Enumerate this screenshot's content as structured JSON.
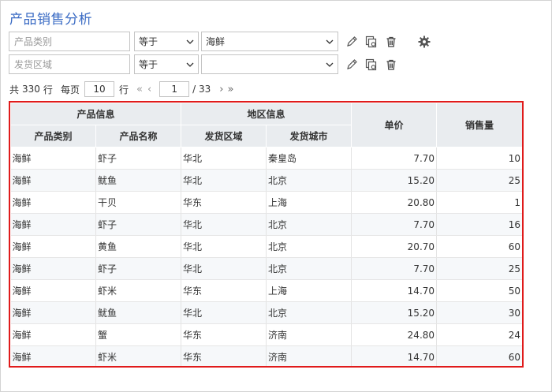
{
  "title": "产品销售分析",
  "filters": [
    {
      "field_placeholder": "产品类别",
      "operator": "等于",
      "value": "海鲜"
    },
    {
      "field_placeholder": "发货区域",
      "operator": "等于",
      "value": ""
    }
  ],
  "pager": {
    "total_prefix": "共",
    "total": "330",
    "total_suffix": "行",
    "per_page_label": "每页",
    "per_page": "10",
    "per_page_suffix": "行",
    "current_page": "1",
    "total_pages": "/ 33"
  },
  "table": {
    "group_headers": [
      "产品信息",
      "地区信息"
    ],
    "columns": [
      "产品类别",
      "产品名称",
      "发货区域",
      "发货城市",
      "单价",
      "销售量"
    ],
    "rows": [
      [
        "海鲜",
        "虾子",
        "华北",
        "秦皇岛",
        "7.70",
        "10"
      ],
      [
        "海鲜",
        "鱿鱼",
        "华北",
        "北京",
        "15.20",
        "25"
      ],
      [
        "海鲜",
        "干贝",
        "华东",
        "上海",
        "20.80",
        "1"
      ],
      [
        "海鲜",
        "虾子",
        "华北",
        "北京",
        "7.70",
        "16"
      ],
      [
        "海鲜",
        "黄鱼",
        "华北",
        "北京",
        "20.70",
        "60"
      ],
      [
        "海鲜",
        "虾子",
        "华北",
        "北京",
        "7.70",
        "25"
      ],
      [
        "海鲜",
        "虾米",
        "华东",
        "上海",
        "14.70",
        "50"
      ],
      [
        "海鲜",
        "鱿鱼",
        "华北",
        "北京",
        "15.20",
        "30"
      ],
      [
        "海鲜",
        "蟹",
        "华东",
        "济南",
        "24.80",
        "24"
      ],
      [
        "海鲜",
        "虾米",
        "华东",
        "济南",
        "14.70",
        "60"
      ]
    ]
  },
  "colors": {
    "title": "#3a6bc4",
    "highlight_border": "#e01b1b",
    "header_bg": "#e9ecef"
  }
}
